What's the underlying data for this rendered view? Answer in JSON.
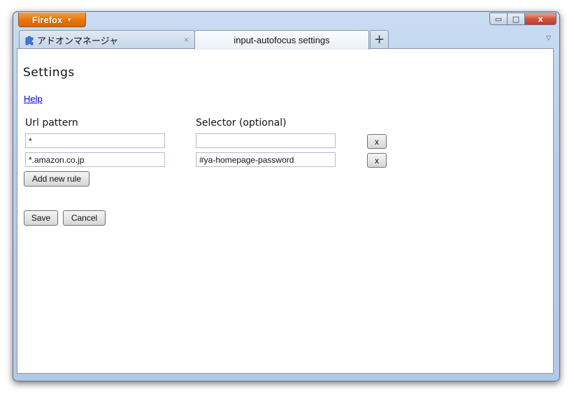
{
  "window": {
    "app_menu_label": "Firefox",
    "controls": {
      "minimize": "▭",
      "maximize": "□",
      "close": "x"
    }
  },
  "tabs": [
    {
      "label": "アドオンマネージャ",
      "icon": "puzzle-piece-icon",
      "close": "×",
      "active": false
    },
    {
      "label": "input-autofocus settings",
      "active": true
    }
  ],
  "tabstrip": {
    "new_tab": "+",
    "list_all_tabs": "▽"
  },
  "page": {
    "title": "Settings",
    "help_link": "Help",
    "columns": {
      "url": "Url pattern",
      "selector": "Selector (optional)"
    },
    "rules": [
      {
        "url": "*",
        "selector": "",
        "remove_label": "x"
      },
      {
        "url": "*.amazon.co.jp",
        "selector": "#ya-homepage-password",
        "remove_label": "x"
      }
    ],
    "add_rule_label": "Add new rule",
    "save_label": "Save",
    "cancel_label": "Cancel"
  },
  "colors": {
    "accent_orange": "#e8760d",
    "link": "#0000ee",
    "close_red": "#c23a26"
  }
}
